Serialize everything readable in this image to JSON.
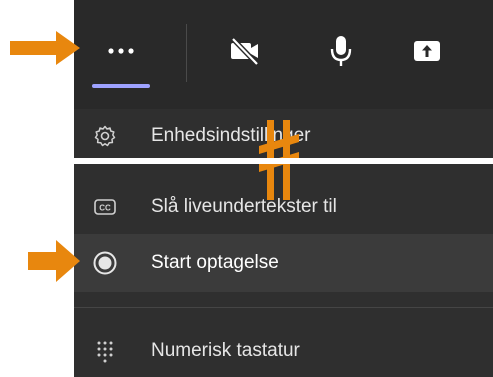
{
  "toolbar": {
    "more_icon": "more-options-icon",
    "camera_icon": "camera-off-icon",
    "mic_icon": "microphone-icon",
    "share_icon": "share-screen-icon"
  },
  "menu": {
    "device_settings": "Enhedsindstillinger",
    "live_captions": "Slå liveundertekster til",
    "start_recording": "Start optagelse",
    "dial_pad": "Numerisk tastatur"
  },
  "colors": {
    "background": "#292929",
    "menu": "#2f2f2f",
    "highlight": "#3b3b3b",
    "accent": "#9ea2ff",
    "annotation": "#e8870e"
  }
}
